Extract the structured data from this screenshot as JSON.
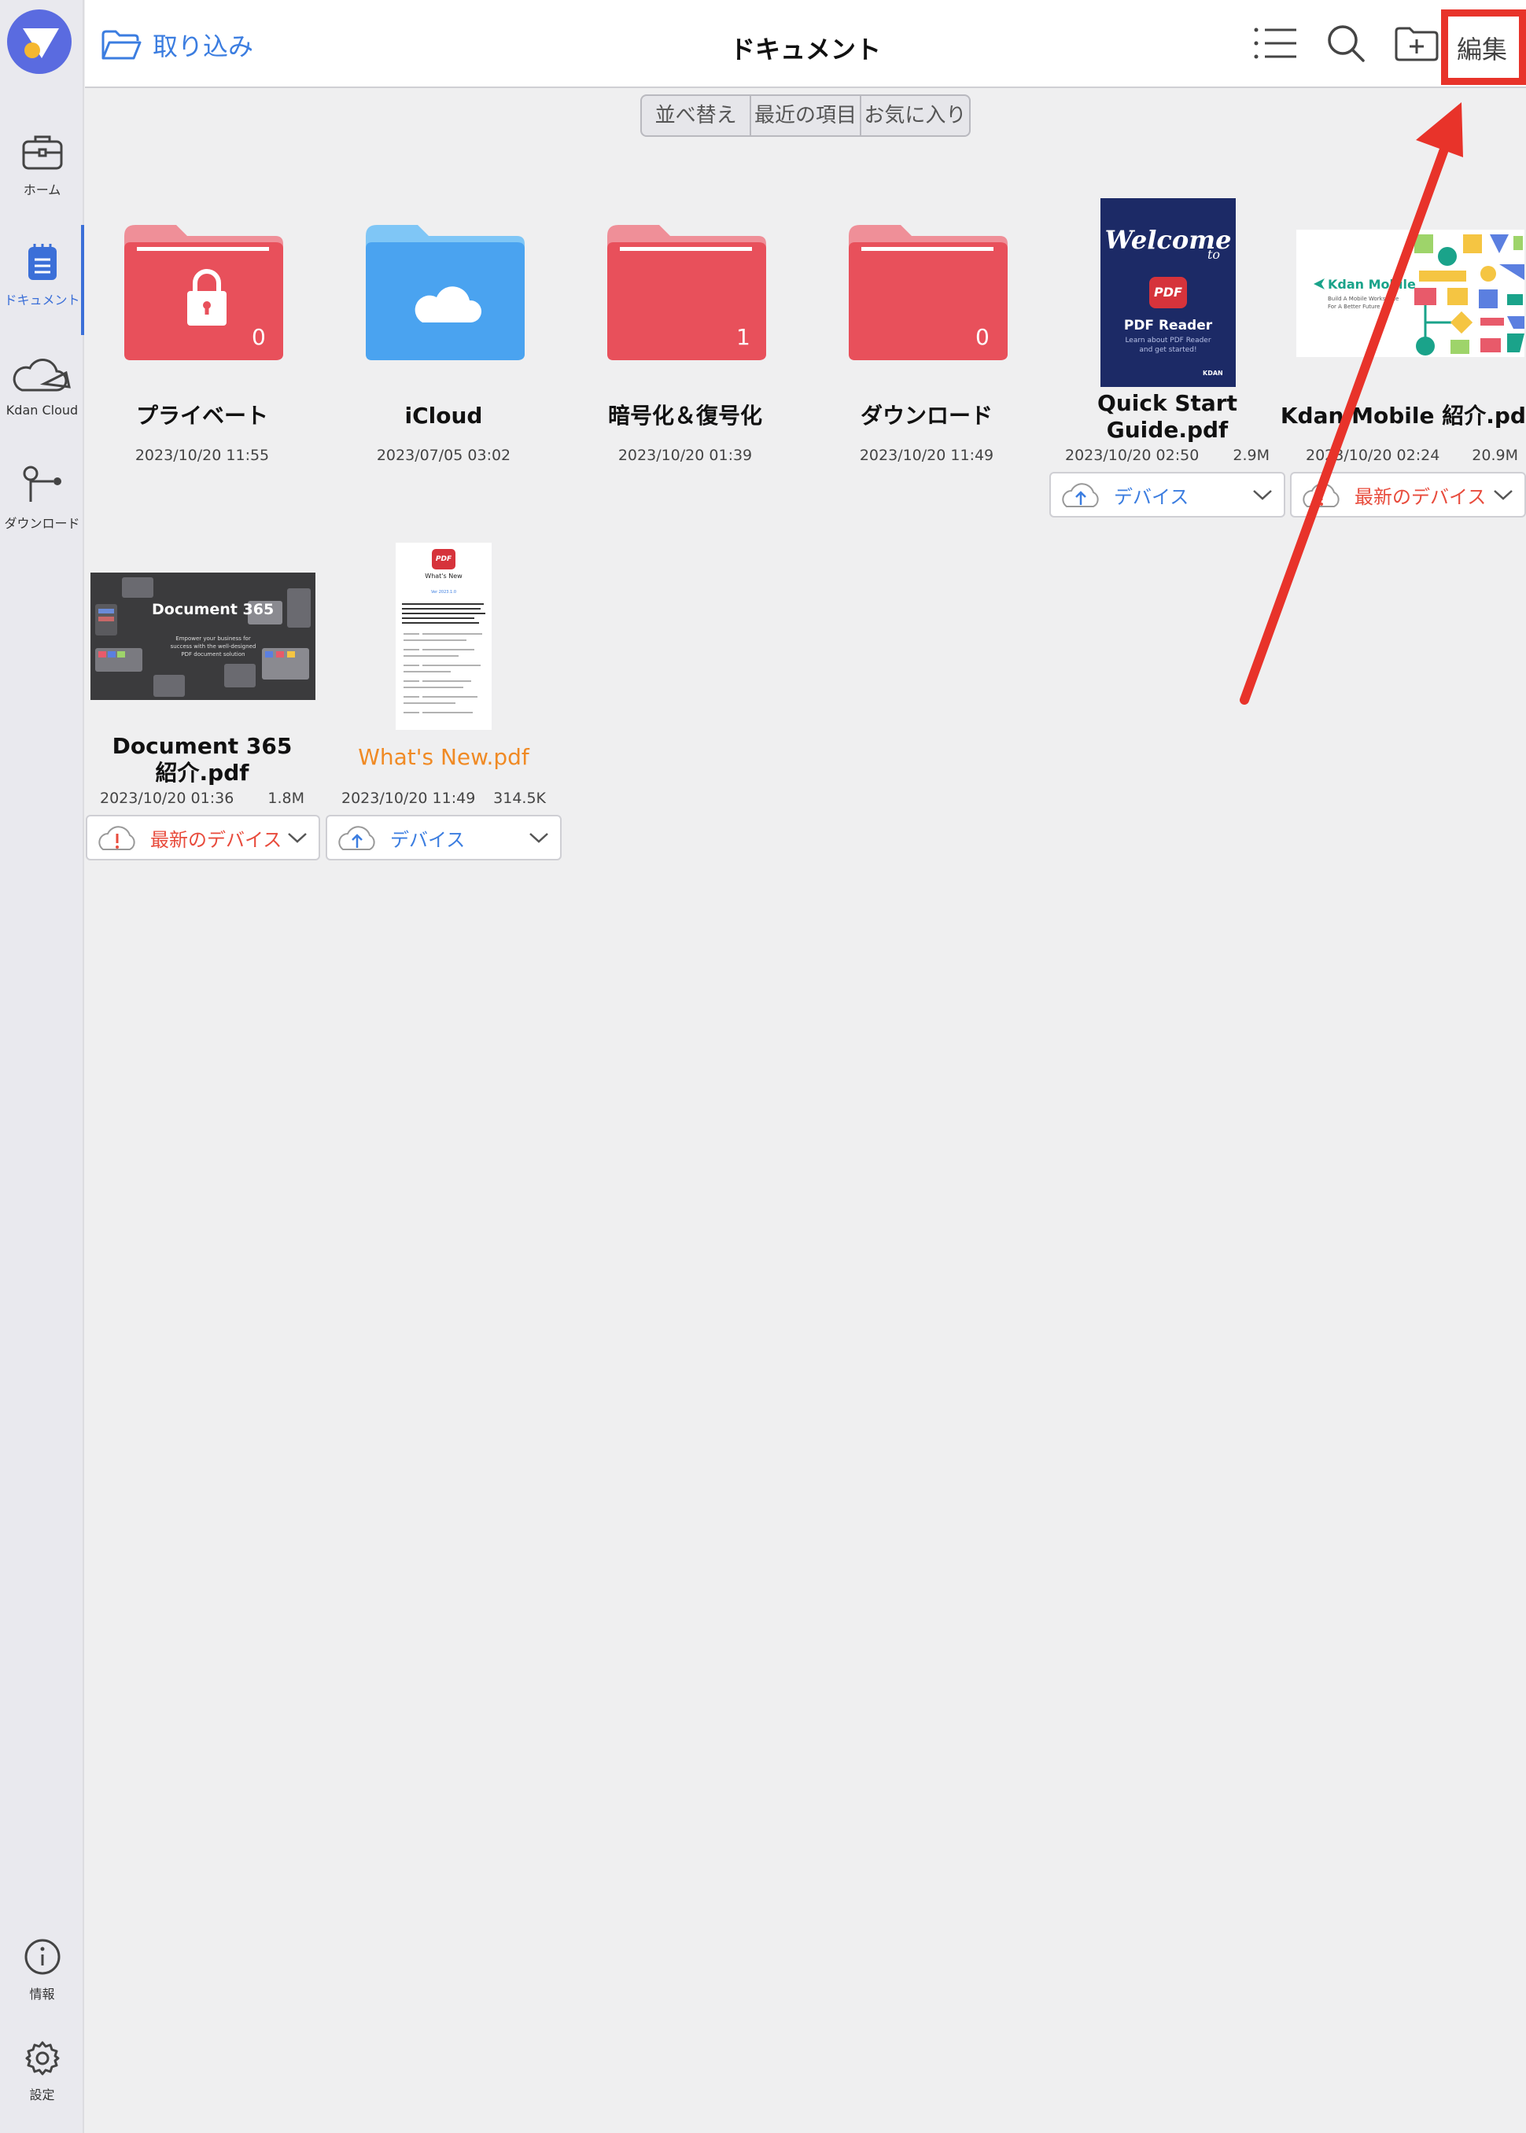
{
  "header": {
    "import_label": "取り込み",
    "title": "ドキュメント",
    "edit_label": "編集"
  },
  "segments": [
    "並べ替え",
    "最近の項目",
    "お気に入り"
  ],
  "sidebar": {
    "items": [
      {
        "label": "ホーム",
        "icon": "briefcase-icon"
      },
      {
        "label": "ドキュメント",
        "icon": "document-icon"
      },
      {
        "label": "Kdan Cloud",
        "icon": "cloud-icon"
      },
      {
        "label": "ダウンロード",
        "icon": "download-icon"
      }
    ],
    "bottom": [
      {
        "label": "情報",
        "icon": "info-icon"
      },
      {
        "label": "設定",
        "icon": "gear-icon"
      }
    ]
  },
  "folders": [
    {
      "name": "プライベート",
      "date": "2023/10/20 11:55",
      "count": "0",
      "color": "#e8505b",
      "icon": "lock-icon"
    },
    {
      "name": "iCloud",
      "date": "2023/07/05 03:02",
      "count": "",
      "color": "#4aa3f0",
      "icon": "cloud-icon"
    },
    {
      "name": "暗号化＆復号化",
      "date": "2023/10/20 01:39",
      "count": "1",
      "color": "#e8505b",
      "icon": ""
    },
    {
      "name": "ダウンロード",
      "date": "2023/10/20 11:49",
      "count": "0",
      "color": "#e8505b",
      "icon": ""
    }
  ],
  "files": [
    {
      "name_line1": "Quick Start",
      "name_line2": "Guide.pdf",
      "date": "2023/10/20 02:50",
      "size": "2.9M",
      "status": "デバイス",
      "status_type": "upload"
    },
    {
      "name": "Kdan Mobile 紹介.pdf",
      "date": "2023/10/20 02:24",
      "size": "20.9M",
      "status": "最新のデバイス",
      "status_type": "warning"
    },
    {
      "name_line1": "Document 365",
      "name_line2": "紹介.pdf",
      "date": "2023/10/20 01:36",
      "size": "1.8M",
      "status": "最新のデバイス",
      "status_type": "warning"
    },
    {
      "name": "What's New.pdf",
      "date": "2023/10/20 11:49",
      "size": "314.5K",
      "status": "デバイス",
      "status_type": "upload"
    }
  ],
  "thumbnails": {
    "quick_start": {
      "line1": "Welcome",
      "line2": "to",
      "badge": "PDF",
      "title": "PDF Reader",
      "sub1": "Learn about PDF Reader",
      "sub2": "and get started!",
      "brand": "KDAN"
    },
    "kdan_mobile": {
      "brand": "Kdan Mobile",
      "sub1": "Build A Mobile Workspace",
      "sub2": "For A Better Future"
    },
    "doc365": {
      "brand": "Document 365",
      "sub1": "Empower your business for",
      "sub2": "success with the well-designed",
      "sub3": "PDF document solution"
    },
    "whats_new": {
      "badge": "PDF",
      "title": "What's New",
      "version": "Ver 2023.1.0"
    }
  },
  "colors": {
    "accent": "#3b7de0",
    "folder_red": "#e8505b",
    "folder_blue": "#4aa3f0",
    "highlight": "#e8332a",
    "orange_name": "#f08a24"
  }
}
